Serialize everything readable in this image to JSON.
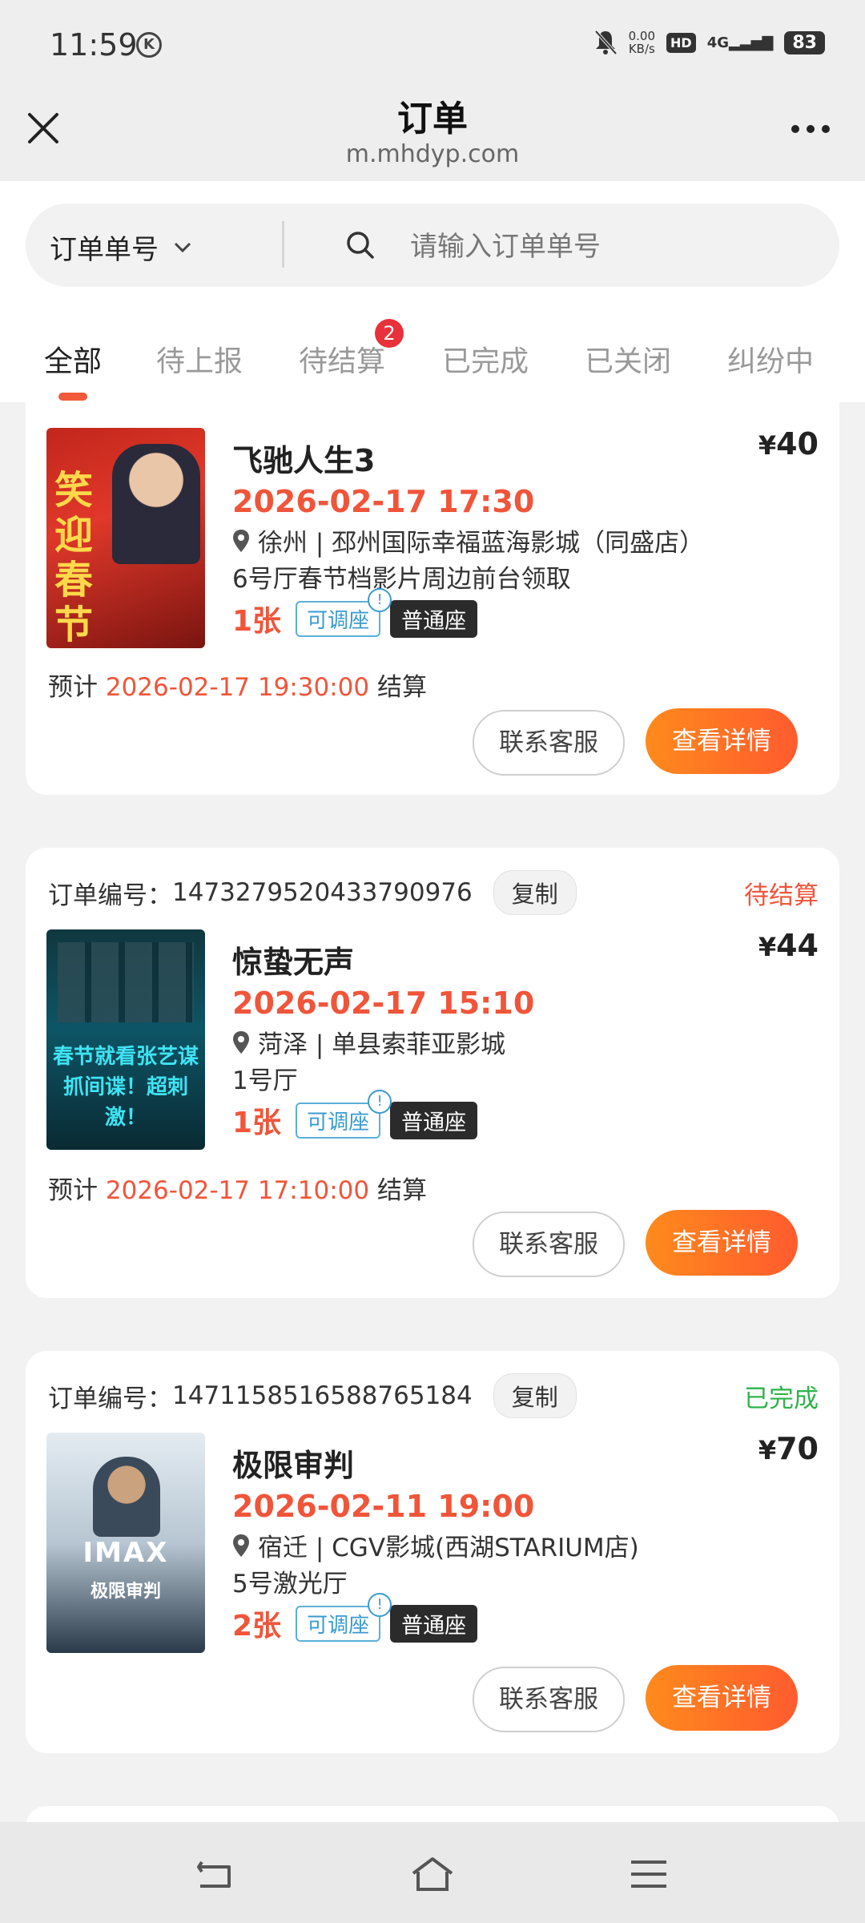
{
  "status_bar": {
    "time": "11:59",
    "speed_value": "0.00",
    "speed_unit": "KB/s",
    "hd": "HD",
    "network": "4G",
    "battery": "83"
  },
  "header": {
    "title": "订单",
    "url": "m.mhdyp.com"
  },
  "search": {
    "type_label": "订单单号",
    "placeholder": "请输入订单单号"
  },
  "tabs": [
    {
      "label": "全部",
      "active": true
    },
    {
      "label": "待上报"
    },
    {
      "label": "待结算",
      "badge": "2"
    },
    {
      "label": "已完成"
    },
    {
      "label": "已关闭"
    },
    {
      "label": "纠纷中"
    }
  ],
  "orders": [
    {
      "movie": "飞驰人生3",
      "price_symbol": "¥",
      "price": "40",
      "show_time": "2026-02-17 17:30",
      "cinema": "徐州 | 邳州国际幸福蓝海影城（同盛店）",
      "hall": "6号厅春节档影片周边前台领取",
      "qty": "1张",
      "tag_adjust": "可调座",
      "tag_seat": "普通座",
      "settle_prefix": "预计",
      "settle_time": "2026-02-17 19:30:00",
      "settle_suffix": "结算",
      "btn_service": "联系客服",
      "btn_detail": "查看详情",
      "poster_text": "笑迎春节"
    },
    {
      "order_label": "订单编号：",
      "order_no": "1473279520433790976",
      "copy": "复制",
      "status": "待结算",
      "status_color": "#f0553a",
      "movie": "惊蛰无声",
      "price_symbol": "¥",
      "price": "44",
      "show_time": "2026-02-17 15:10",
      "cinema": "菏泽 | 单县索菲亚影城",
      "hall": "1号厅",
      "qty": "1张",
      "tag_adjust": "可调座",
      "tag_seat": "普通座",
      "settle_prefix": "预计",
      "settle_time": "2026-02-17 17:10:00",
      "settle_suffix": "结算",
      "btn_service": "联系客服",
      "btn_detail": "查看详情",
      "poster_text_1": "春节就看张艺谋",
      "poster_text_2": "抓间谍！超刺激！"
    },
    {
      "order_label": "订单编号：",
      "order_no": "1471158516588765184",
      "copy": "复制",
      "status": "已完成",
      "status_color": "#2fb34a",
      "movie": "极限审判",
      "price_symbol": "¥",
      "price": "70",
      "show_time": "2026-02-11 19:00",
      "cinema": "宿迁 | CGV影城(西湖STARIUM店)",
      "hall": "5号激光厅",
      "qty": "2张",
      "tag_adjust": "可调座",
      "tag_seat": "普通座",
      "btn_service": "联系客服",
      "btn_detail": "查看详情",
      "poster_text_1": "IMAX",
      "poster_text_2": "极限审判"
    }
  ],
  "icons": {
    "close": "close-icon",
    "more": "more-icon",
    "search": "search-icon",
    "chevron": "chevron-down-icon",
    "location": "location-pin-icon",
    "back": "back-icon",
    "home": "home-icon",
    "menu": "menu-icon"
  }
}
